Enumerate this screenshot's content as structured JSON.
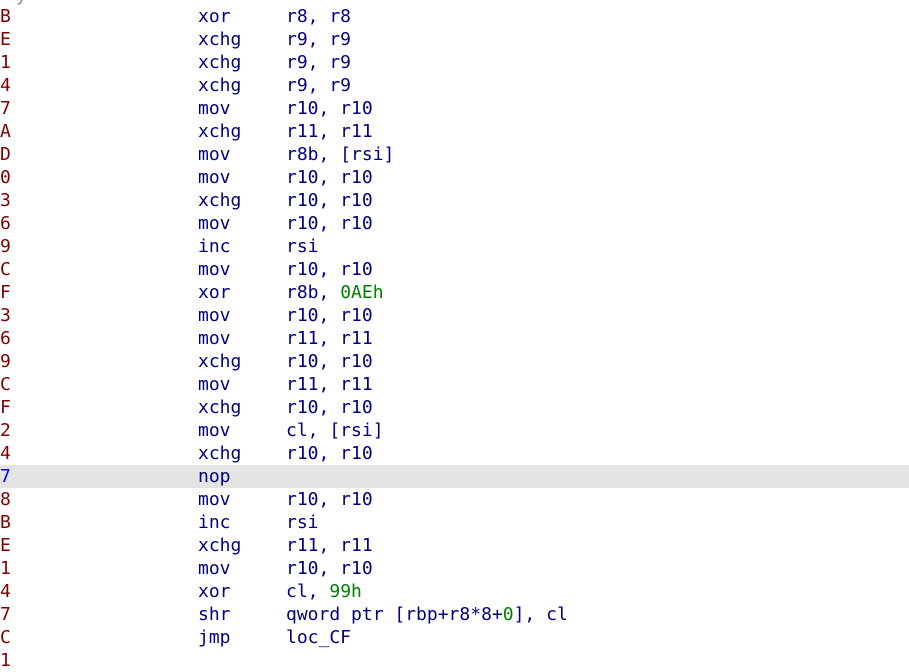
{
  "colors": {
    "background": "#ffffff",
    "address": "#7f0000",
    "address_highlight": "#0000ff",
    "mnemonic": "#000080",
    "operand": "#000080",
    "number": "#008000",
    "highlight_row": "#e4e4e4"
  },
  "listing": {
    "top_clip_text": "y",
    "bottom_clip_text": "1",
    "rows": [
      {
        "addr": "B",
        "mnem": "xor",
        "ops": [
          {
            "t": "r8, r8",
            "k": "reg"
          }
        ]
      },
      {
        "addr": "E",
        "mnem": "xchg",
        "ops": [
          {
            "t": "r9, r9",
            "k": "reg"
          }
        ]
      },
      {
        "addr": "1",
        "mnem": "xchg",
        "ops": [
          {
            "t": "r9, r9",
            "k": "reg"
          }
        ]
      },
      {
        "addr": "4",
        "mnem": "xchg",
        "ops": [
          {
            "t": "r9, r9",
            "k": "reg"
          }
        ]
      },
      {
        "addr": "7",
        "mnem": "mov",
        "ops": [
          {
            "t": "r10, r10",
            "k": "reg"
          }
        ]
      },
      {
        "addr": "A",
        "mnem": "xchg",
        "ops": [
          {
            "t": "r11, r11",
            "k": "reg"
          }
        ]
      },
      {
        "addr": "D",
        "mnem": "mov",
        "ops": [
          {
            "t": "r8b, [rsi]",
            "k": "reg"
          }
        ]
      },
      {
        "addr": "0",
        "mnem": "mov",
        "ops": [
          {
            "t": "r10, r10",
            "k": "reg"
          }
        ]
      },
      {
        "addr": "3",
        "mnem": "xchg",
        "ops": [
          {
            "t": "r10, r10",
            "k": "reg"
          }
        ]
      },
      {
        "addr": "6",
        "mnem": "mov",
        "ops": [
          {
            "t": "r10, r10",
            "k": "reg"
          }
        ]
      },
      {
        "addr": "9",
        "mnem": "inc",
        "ops": [
          {
            "t": "rsi",
            "k": "reg"
          }
        ]
      },
      {
        "addr": "C",
        "mnem": "mov",
        "ops": [
          {
            "t": "r10, r10",
            "k": "reg"
          }
        ]
      },
      {
        "addr": "F",
        "mnem": "xor",
        "ops": [
          {
            "t": "r8b, ",
            "k": "reg"
          },
          {
            "t": "0AEh",
            "k": "num"
          }
        ]
      },
      {
        "addr": "3",
        "mnem": "mov",
        "ops": [
          {
            "t": "r10, r10",
            "k": "reg"
          }
        ]
      },
      {
        "addr": "6",
        "mnem": "mov",
        "ops": [
          {
            "t": "r11, r11",
            "k": "reg"
          }
        ]
      },
      {
        "addr": "9",
        "mnem": "xchg",
        "ops": [
          {
            "t": "r10, r10",
            "k": "reg"
          }
        ]
      },
      {
        "addr": "C",
        "mnem": "mov",
        "ops": [
          {
            "t": "r11, r11",
            "k": "reg"
          }
        ]
      },
      {
        "addr": "F",
        "mnem": "xchg",
        "ops": [
          {
            "t": "r10, r10",
            "k": "reg"
          }
        ]
      },
      {
        "addr": "2",
        "mnem": "mov",
        "ops": [
          {
            "t": "cl, [rsi]",
            "k": "reg"
          }
        ]
      },
      {
        "addr": "4",
        "mnem": "xchg",
        "ops": [
          {
            "t": "r10, r10",
            "k": "reg"
          }
        ]
      },
      {
        "addr": "7",
        "mnem": "nop",
        "ops": [],
        "highlighted": true
      },
      {
        "addr": "8",
        "mnem": "mov",
        "ops": [
          {
            "t": "r10, r10",
            "k": "reg"
          }
        ]
      },
      {
        "addr": "B",
        "mnem": "inc",
        "ops": [
          {
            "t": "rsi",
            "k": "reg"
          }
        ]
      },
      {
        "addr": "E",
        "mnem": "xchg",
        "ops": [
          {
            "t": "r11, r11",
            "k": "reg"
          }
        ]
      },
      {
        "addr": "1",
        "mnem": "mov",
        "ops": [
          {
            "t": "r10, r10",
            "k": "reg"
          }
        ]
      },
      {
        "addr": "4",
        "mnem": "xor",
        "ops": [
          {
            "t": "cl, ",
            "k": "reg"
          },
          {
            "t": "99h",
            "k": "num"
          }
        ]
      },
      {
        "addr": "7",
        "mnem": "shr",
        "ops": [
          {
            "t": "qword ptr [rbp+r8*8+",
            "k": "reg"
          },
          {
            "t": "0",
            "k": "num"
          },
          {
            "t": "], cl",
            "k": "reg"
          }
        ]
      },
      {
        "addr": "C",
        "mnem": "jmp",
        "ops": [
          {
            "t": "loc_CF",
            "k": "reg"
          }
        ]
      }
    ]
  }
}
